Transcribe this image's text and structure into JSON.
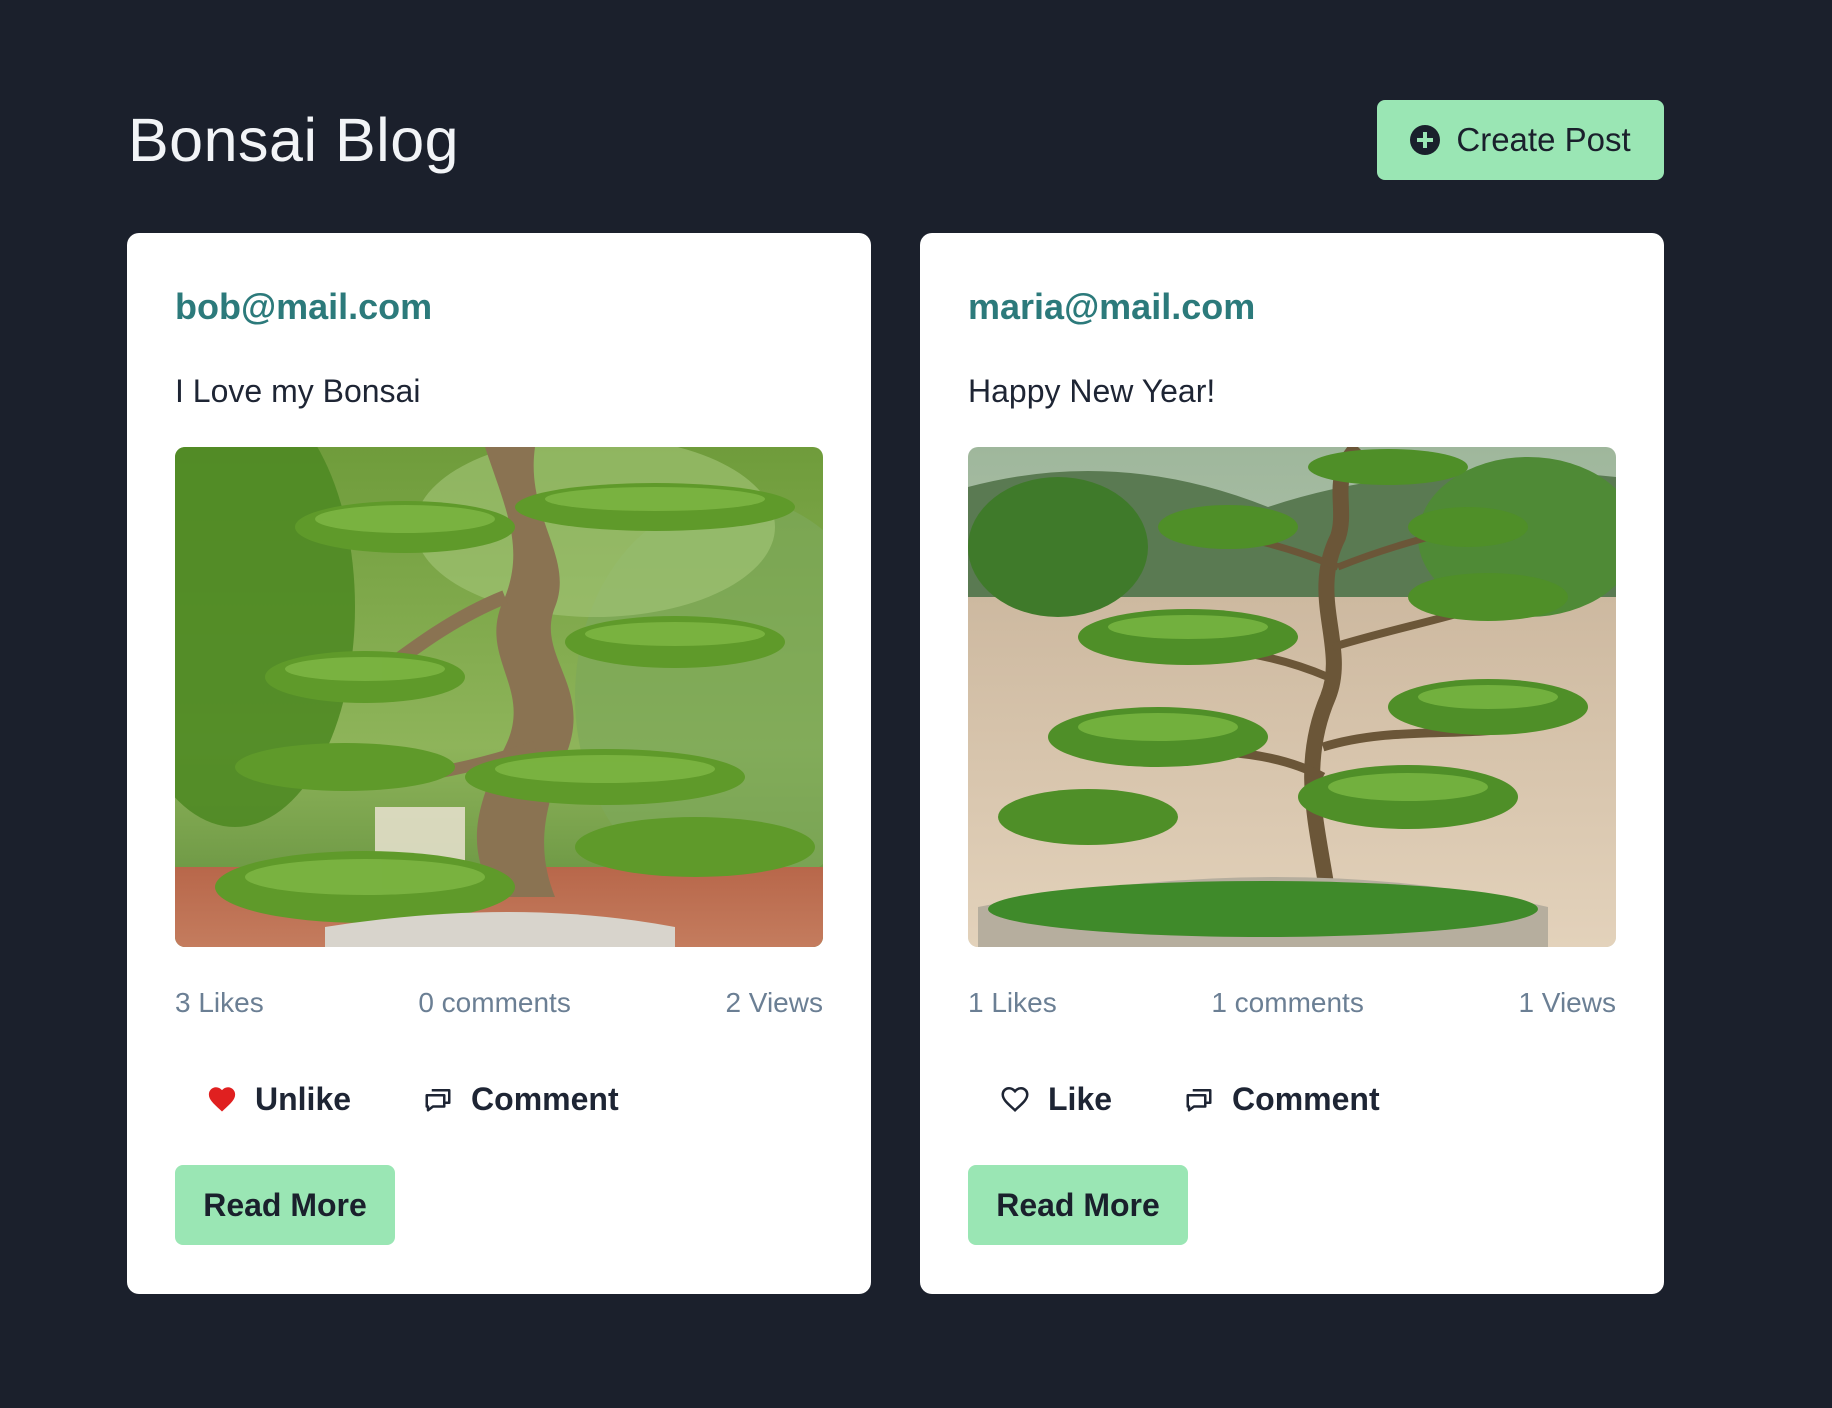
{
  "header": {
    "title": "Bonsai Blog",
    "create_post_label": "Create Post"
  },
  "colors": {
    "background": "#1b202c",
    "accent": "#9ae6b4",
    "author": "#2c7a7b",
    "like_active": "#e02020"
  },
  "posts": [
    {
      "author": "bob@mail.com",
      "title": "I Love my Bonsai",
      "image_icon": "bonsai-tree-photo",
      "likes": "3 Likes",
      "comments": "0 comments",
      "views": "2 Views",
      "like_label": "Unlike",
      "like_icon": "heart-filled-icon",
      "comment_label": "Comment",
      "comment_icon": "comment-icon",
      "read_more_label": "Read More"
    },
    {
      "author": "maria@mail.com",
      "title": "Happy New Year!",
      "image_icon": "bonsai-tree-photo",
      "likes": "1 Likes",
      "comments": "1 comments",
      "views": "1 Views",
      "like_label": "Like",
      "like_icon": "heart-outline-icon",
      "comment_label": "Comment",
      "comment_icon": "comment-icon",
      "read_more_label": "Read More"
    }
  ]
}
